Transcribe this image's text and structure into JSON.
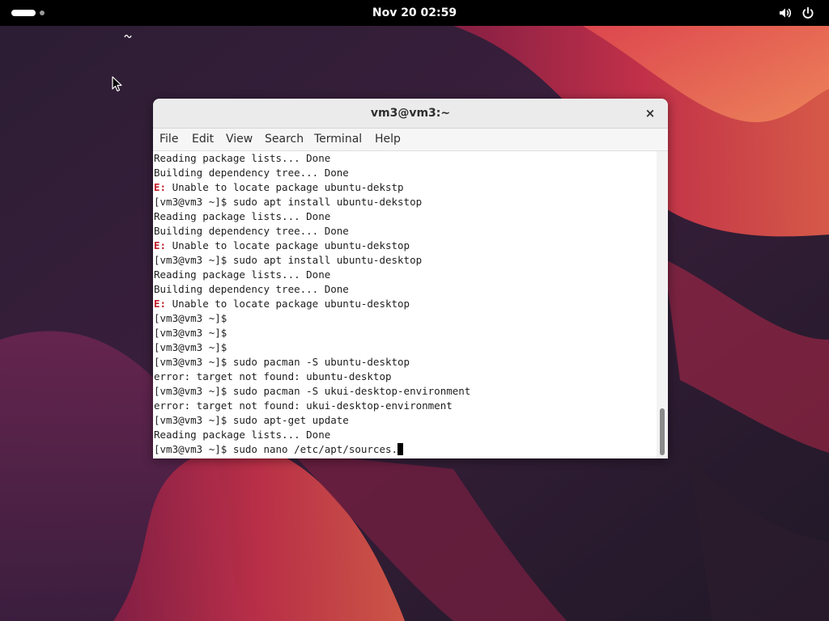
{
  "topbar": {
    "clock": "Nov 20  02:59",
    "icons": [
      "activities-indicator",
      "volume-icon",
      "power-icon"
    ]
  },
  "window": {
    "title": "vm3@vm3:~",
    "close_label": "×",
    "menu": [
      "File",
      "Edit",
      "View",
      "Search",
      "Terminal",
      "Help"
    ]
  },
  "terminal": {
    "lines": [
      {
        "prefix": "",
        "text": "Reading package lists... Done"
      },
      {
        "prefix": "",
        "text": "Building dependency tree... Done"
      },
      {
        "prefix": "E:",
        "text": " Unable to locate package ubuntu-dekstp"
      },
      {
        "prefix": "",
        "text": "[vm3@vm3 ~]$ sudo apt install ubuntu-dekstop"
      },
      {
        "prefix": "",
        "text": "Reading package lists... Done"
      },
      {
        "prefix": "",
        "text": "Building dependency tree... Done"
      },
      {
        "prefix": "E:",
        "text": " Unable to locate package ubuntu-dekstop"
      },
      {
        "prefix": "",
        "text": "[vm3@vm3 ~]$ sudo apt install ubuntu-desktop"
      },
      {
        "prefix": "",
        "text": "Reading package lists... Done"
      },
      {
        "prefix": "",
        "text": "Building dependency tree... Done"
      },
      {
        "prefix": "E:",
        "text": " Unable to locate package ubuntu-desktop"
      },
      {
        "prefix": "",
        "text": "[vm3@vm3 ~]$"
      },
      {
        "prefix": "",
        "text": "[vm3@vm3 ~]$"
      },
      {
        "prefix": "",
        "text": "[vm3@vm3 ~]$"
      },
      {
        "prefix": "",
        "text": "[vm3@vm3 ~]$ sudo pacman -S ubuntu-desktop"
      },
      {
        "prefix": "",
        "text": "error: target not found: ubuntu-desktop"
      },
      {
        "prefix": "",
        "text": "[vm3@vm3 ~]$ sudo pacman -S ukui-desktop-environment"
      },
      {
        "prefix": "",
        "text": "error: target not found: ukui-desktop-environment"
      },
      {
        "prefix": "",
        "text": "[vm3@vm3 ~]$ sudo apt-get update"
      },
      {
        "prefix": "",
        "text": "Reading package lists... Done"
      }
    ],
    "current_prompt": "[vm3@vm3 ~]$ sudo nano /etc/apt/sources.",
    "scroll_position": 0.84
  },
  "colors": {
    "topbar": "#000000",
    "error_prefix": "#c01c28",
    "terminal_bg": "#ffffff",
    "titlebar_bg": "#ebebeb"
  }
}
